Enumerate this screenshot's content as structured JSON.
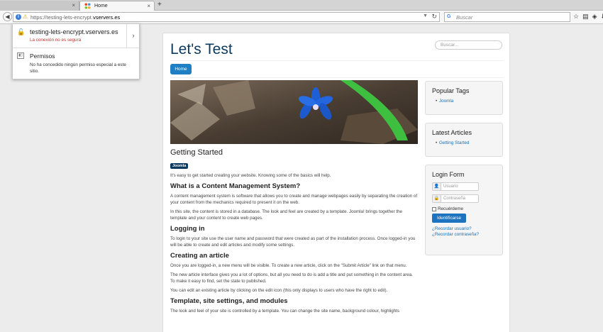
{
  "browser": {
    "prev_tab_close": "×",
    "active_tab_title": "Home",
    "active_tab_close": "×",
    "new_tab": "+",
    "url_prefix": "https://testing-lets-encrypt.",
    "url_domain": "vservers.es",
    "search_placeholder": "Buscar",
    "colors": {
      "accent": "#3a7dd8",
      "warning": "#d49a00"
    }
  },
  "popup": {
    "host": "testing-lets-encrypt.vservers.es",
    "status": "La conexión no es segura",
    "status_color": "#c03030",
    "permissions_title": "Permisos",
    "permissions_text": "No ha concedido ningún permiso especial a este sitio."
  },
  "site": {
    "title": "Let's Test",
    "search_placeholder": "Buscar...",
    "nav": [
      "Home"
    ],
    "colors": {
      "brand": "#0b3a5e",
      "button": "#1e7fc3"
    }
  },
  "article": {
    "title": "Getting Started",
    "tag": "Joomla",
    "intro": "It's easy to get started creating your website. Knowing some of the basics will help.",
    "sections": [
      {
        "heading": "What is a Content Management System?",
        "paragraphs": [
          "A content management system is software that allows you to create and manage webpages easily by separating the creation of your content from the mechanics required to present it on the web.",
          "In this site, the content is stored in a database. The look and feel are created by a template. Joomla! brings together the template and your content to create web pages."
        ]
      },
      {
        "heading": "Logging in",
        "paragraphs": [
          "To login to your site use the user name and password that were created as part of the installation process. Once logged-in you will be able to create and edit articles and modify some settings."
        ]
      },
      {
        "heading": "Creating an article",
        "paragraphs": [
          "Once you are logged-in, a new menu will be visible. To create a new article, click on the \"Submit Article\" link on that menu.",
          "The new article interface gives you a lot of options, but all you need to do is add a title and put something in the content area. To make it easy to find, set the state to published.",
          "You can edit an existing article by clicking on the edit icon (this only displays to users who have the right to edit)."
        ]
      },
      {
        "heading": "Template, site settings, and modules",
        "paragraphs": [
          "The look and feel of your site is controlled by a template. You can change the site name, background colour, highlights"
        ]
      }
    ]
  },
  "sidebar": {
    "popular_tags": {
      "title": "Popular Tags",
      "items": [
        "Joomla"
      ]
    },
    "latest_articles": {
      "title": "Latest Articles",
      "items": [
        "Getting Started"
      ]
    },
    "login": {
      "title": "Login Form",
      "username_placeholder": "Usuario",
      "password_placeholder": "Contraseña",
      "remember_label": "Recuérdeme",
      "submit_label": "Identificarse",
      "forgot_user": "¿Recordar usuario?",
      "forgot_password": "¿Recordar contraseña?"
    }
  }
}
